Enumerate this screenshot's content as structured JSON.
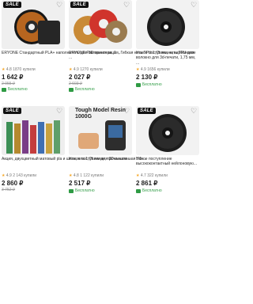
{
  "products": [
    {
      "sale": "SALE",
      "title": "ERYONE Стандартный PLA+ наполнитель для 3D принтера, 1 ...",
      "rating": "4.8",
      "sold": "1870 купили",
      "price": "1 642 ₽",
      "old_price": "2 055 ₽",
      "shipping": "Бесплатно"
    },
    {
      "sale": "SALE",
      "title": "ERYONE Рекламная акция, Гибкая нить TPU 1,75 мм, нить TPU для ...",
      "rating": "4.9",
      "sold": "1270 купили",
      "price": "2 027 ₽",
      "old_price": "2 603 ₽",
      "shipping": "Бесплатно"
    },
    {
      "sale": "",
      "title": "Новое поступление, карбоновое волокно для 3d-печати, 1,75 мм, ...",
      "rating": "4.9",
      "sold": "1656 купили",
      "price": "2 130 ₽",
      "old_price": "",
      "shipping": "Бесплатно"
    },
    {
      "sale": "SALE",
      "title": "Акция, двухцветный матовый pla и шелк, пла 1,75 мм для 3D-печати...",
      "rating": "4.9",
      "sold": "2 143 купили",
      "price": "2 860 ₽",
      "old_price": "3 752 ₽",
      "shipping": ""
    },
    {
      "sale": "",
      "image_text": "Tough Model Resin 1000G",
      "title": "Новое поступление, промышленная УФ-...",
      "rating": "4.8",
      "sold": "1 122 купили",
      "price": "2 517 ₽",
      "old_price": "",
      "shipping": "Бесплатно"
    },
    {
      "sale": "SALE",
      "title": "Новое поступление высококонтактный нейлоновую...",
      "rating": "4.7",
      "sold": "322 купили",
      "price": "2 861 ₽",
      "old_price": "",
      "shipping": "Бесплатно"
    }
  ]
}
